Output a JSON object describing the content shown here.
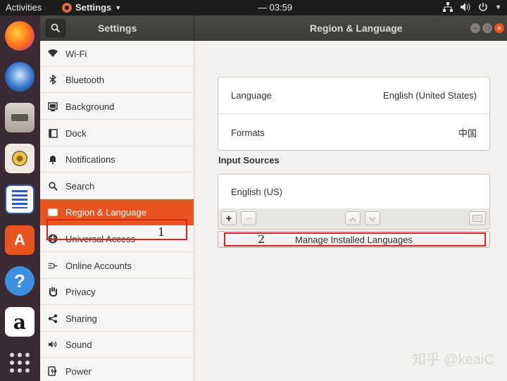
{
  "topbar": {
    "activities": "Activities",
    "app_menu": "Settings",
    "clock": "— 03:59"
  },
  "dock": {
    "items": [
      "firefox-icon",
      "thunderbird-icon",
      "files-icon",
      "rhythmbox-icon",
      "libreoffice-writer-icon",
      "ubuntu-software-icon",
      "help-icon",
      "amazon-icon",
      "show-applications-icon"
    ]
  },
  "window": {
    "sidebar_title": "Settings",
    "panel_title": "Region & Language"
  },
  "sidebar": {
    "items": [
      {
        "label": "Wi-Fi",
        "icon": "wifi-icon"
      },
      {
        "label": "Bluetooth",
        "icon": "bluetooth-icon"
      },
      {
        "label": "Background",
        "icon": "background-icon"
      },
      {
        "label": "Dock",
        "icon": "dock-icon"
      },
      {
        "label": "Notifications",
        "icon": "bell-icon"
      },
      {
        "label": "Search",
        "icon": "search-icon"
      },
      {
        "label": "Region & Language",
        "icon": "flag-icon",
        "selected": true
      },
      {
        "label": "Universal Access",
        "icon": "accessibility-icon"
      },
      {
        "label": "Online Accounts",
        "icon": "online-accounts-icon"
      },
      {
        "label": "Privacy",
        "icon": "hand-icon"
      },
      {
        "label": "Sharing",
        "icon": "share-icon"
      },
      {
        "label": "Sound",
        "icon": "speaker-icon"
      },
      {
        "label": "Power",
        "icon": "power-icon"
      }
    ]
  },
  "region": {
    "language_label": "Language",
    "language_value": "English (United States)",
    "formats_label": "Formats",
    "formats_value": "中国"
  },
  "input_sources": {
    "heading": "Input Sources",
    "items": [
      "English (US)"
    ],
    "add_label": "+",
    "remove_label": "−"
  },
  "manage_button": "Manage Installed Languages",
  "annotations": {
    "n1": "1",
    "n2": "2",
    "color": "#e02020"
  },
  "watermark": "知乎 @keaiC",
  "colors": {
    "accent": "#e95420",
    "dock_bg": "#3a2a33",
    "topbar_bg": "#1d1d1d"
  }
}
